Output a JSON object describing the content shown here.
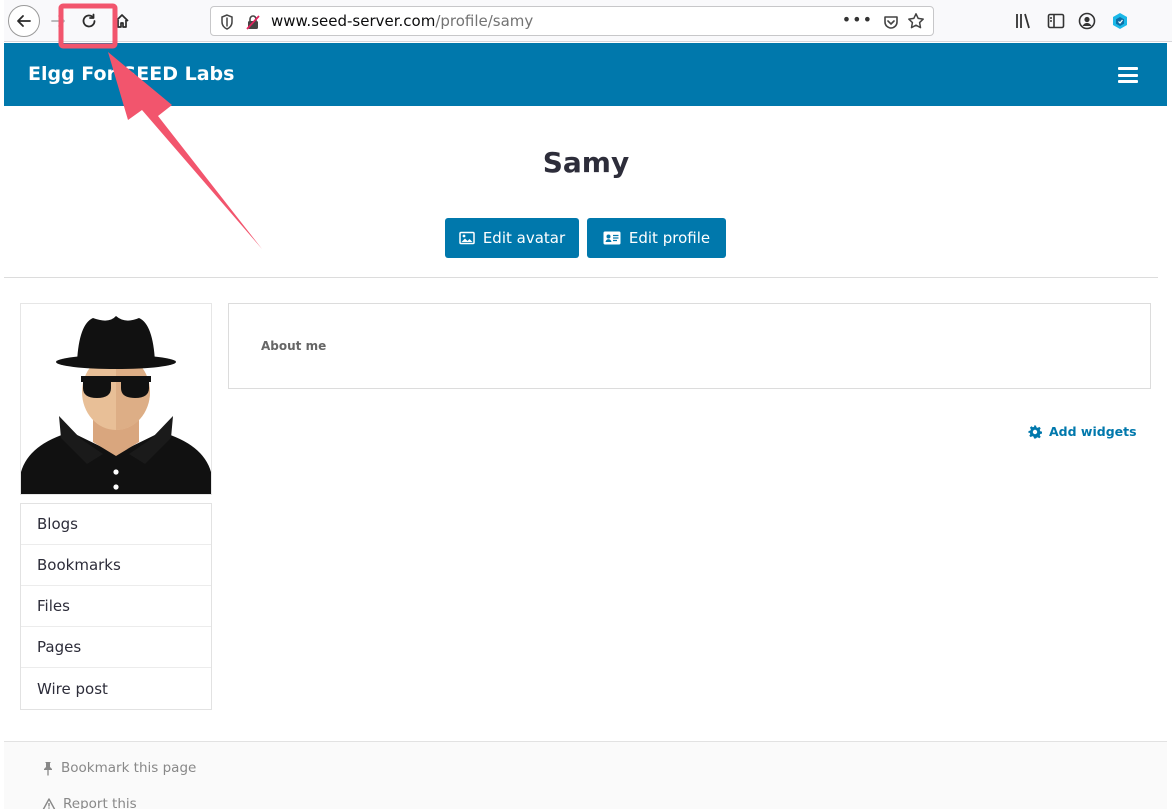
{
  "browser": {
    "url_host": "www.seed-server.com",
    "url_path": "/profile/samy",
    "more_label": "•••"
  },
  "topbar": {
    "site_name": "Elgg For SEED Labs"
  },
  "profile": {
    "name": "Samy",
    "edit_avatar_label": "Edit avatar",
    "edit_profile_label": "Edit profile"
  },
  "sidebar": {
    "items": [
      {
        "label": "Blogs"
      },
      {
        "label": "Bookmarks"
      },
      {
        "label": "Files"
      },
      {
        "label": "Pages"
      },
      {
        "label": "Wire post"
      }
    ]
  },
  "main": {
    "about_title": "About me",
    "add_widgets_label": "Add widgets"
  },
  "footer": {
    "bookmark_label": "Bookmark this page",
    "report_label": "Report this"
  },
  "colors": {
    "brand": "#0078ac",
    "annotation": "#f2556d"
  }
}
